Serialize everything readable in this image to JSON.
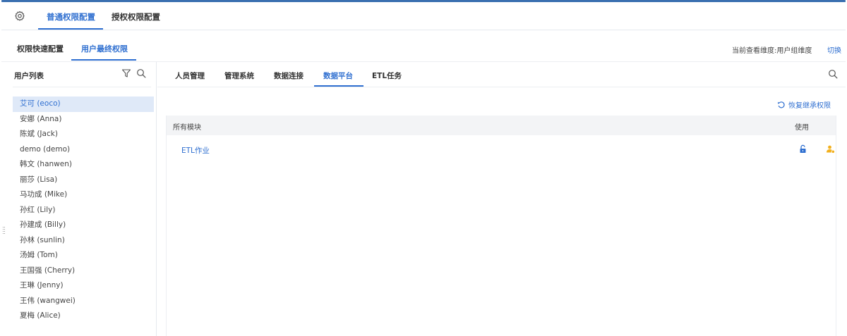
{
  "colors": {
    "accent": "#2f6fd0",
    "selected_bg": "#dfe9f8",
    "warning": "#f2b01e"
  },
  "topbar": {
    "settings_icon": "gear-icon",
    "tabs": [
      {
        "label": "普通权限配置",
        "active": true
      },
      {
        "label": "授权权限配置",
        "active": false
      }
    ]
  },
  "subbar": {
    "tabs": [
      {
        "label": "权限快速配置",
        "active": false
      },
      {
        "label": "用户最终权限",
        "active": true
      }
    ],
    "dimension_text": "当前查看维度:用户组维度",
    "switch_label": "切换"
  },
  "user_panel": {
    "title": "用户列表",
    "filter_icon": "filter-icon",
    "search_icon": "search-icon",
    "users": [
      "艾可 (eoco)",
      "安娜 (Anna)",
      "陈斌 (Jack)",
      "demo (demo)",
      "韩文 (hanwen)",
      "丽莎 (Lisa)",
      "马功成 (Mike)",
      "孙红 (Lily)",
      "孙建成 (Billy)",
      "孙林 (sunlin)",
      "汤姆 (Tom)",
      "王国强 (Cherry)",
      "王琳 (Jenny)",
      "王伟 (wangwei)",
      "夏梅 (Alice)"
    ],
    "selected_index": 0
  },
  "main": {
    "tabs": [
      {
        "label": "人员管理",
        "active": false
      },
      {
        "label": "管理系统",
        "active": false
      },
      {
        "label": "数据连接",
        "active": false
      },
      {
        "label": "数据平台",
        "active": true
      },
      {
        "label": "ETL任务",
        "active": false
      }
    ],
    "restore_label": "恢复继承权限",
    "table": {
      "headers": {
        "module": "所有模块",
        "use": "使用"
      },
      "rows": [
        {
          "name": "ETL作业",
          "lock_icon": "unlock-icon",
          "user_icon": "user-icon"
        }
      ]
    }
  }
}
